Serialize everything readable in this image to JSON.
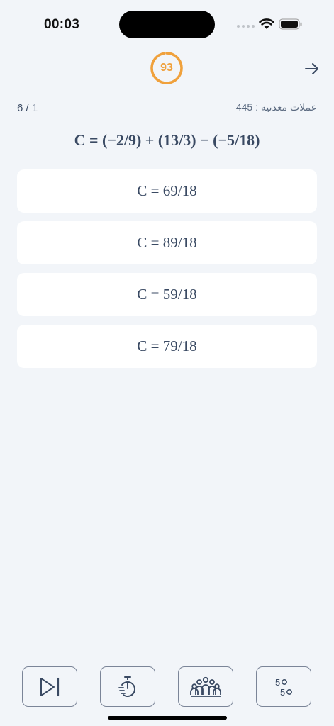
{
  "status_bar": {
    "time": "00:03"
  },
  "header": {
    "timer_value": "93",
    "timer_fraction": 0.97,
    "accent_color": "#f0a13c",
    "next_icon": "arrow-right-icon"
  },
  "progress": {
    "current": "1",
    "separator": " / ",
    "total": "6"
  },
  "coins": {
    "label": "عملات معدنية",
    "separator": " : ",
    "value": "445"
  },
  "question": {
    "text": "C = (−2/9) + (13/3) − (−5/18)"
  },
  "options": [
    {
      "label": "C = 69/18"
    },
    {
      "label": "C = 89/18"
    },
    {
      "label": "C = 59/18"
    },
    {
      "label": "C = 79/18"
    }
  ],
  "toolbar": {
    "skip_icon": "skip-forward-icon",
    "time_icon": "stopwatch-icon",
    "audience_icon": "audience-icon",
    "fifty_icon": "fifty-fifty-icon"
  }
}
